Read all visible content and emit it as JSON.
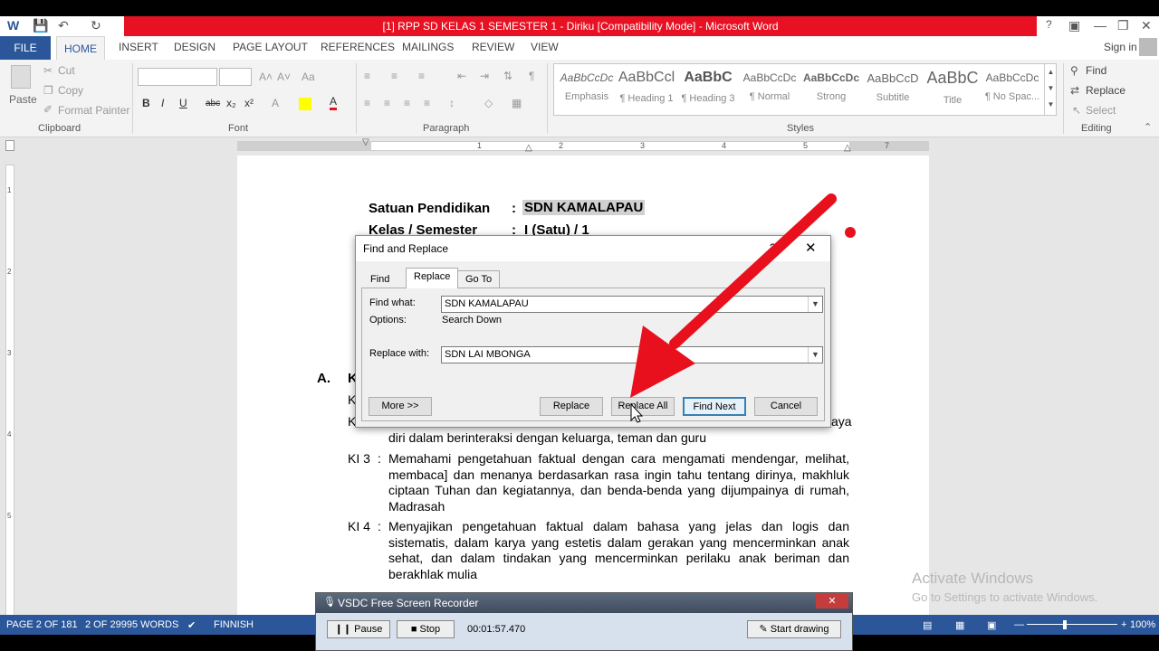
{
  "window": {
    "title": "[1] RPP SD KELAS 1 SEMESTER 1 - Diriku [Compatibility Mode] -  Microsoft Word",
    "help": "?",
    "signin": "Sign in"
  },
  "tabs": [
    "FILE",
    "HOME",
    "INSERT",
    "DESIGN",
    "PAGE LAYOUT",
    "REFERENCES",
    "MAILINGS",
    "REVIEW",
    "VIEW"
  ],
  "clipboard": {
    "paste": "Paste",
    "cut": "Cut",
    "copy": "Copy",
    "format_painter": "Format Painter",
    "group": "Clipboard"
  },
  "font": {
    "group": "Font",
    "bold": "B",
    "italic": "I",
    "underline": "U",
    "strike": "abc",
    "sub": "x₂",
    "sup": "x²",
    "grow": "A˄",
    "shrink": "A˅",
    "case": "Aa"
  },
  "paragraph": {
    "group": "Paragraph"
  },
  "styles": {
    "group": "Styles",
    "items": [
      {
        "preview": "AaBbCcDc",
        "name": "Emphasis"
      },
      {
        "preview": "AaBbCcl",
        "name": "¶ Heading 1"
      },
      {
        "preview": "AaBbC",
        "name": "¶ Heading 3"
      },
      {
        "preview": "AaBbCcDc",
        "name": "¶ Normal"
      },
      {
        "preview": "AaBbCcDc",
        "name": "Strong"
      },
      {
        "preview": "AaBbCcD",
        "name": "Subtitle"
      },
      {
        "preview": "AaBbC",
        "name": "Title"
      },
      {
        "preview": "AaBbCcDc",
        "name": "¶ No Spac..."
      }
    ]
  },
  "editing": {
    "group": "Editing",
    "find": "Find",
    "replace": "Replace",
    "select": "Select"
  },
  "ruler": [
    "1",
    "2",
    "3",
    "4",
    "5",
    "6",
    "7"
  ],
  "vruler": [
    "1",
    "2",
    "3",
    "4",
    "5"
  ],
  "document": {
    "row1_label": "Satuan Pendidikan",
    "row1_colon": ":",
    "row1_value": "SDN KAMALAPAU",
    "row2_label": "Kelas / Semester",
    "row2_colon": ":",
    "row2_value": "I (Satu) / 1",
    "section_letter": "A.",
    "section_initial": "K",
    "ki1_initial": "K",
    "ki2_initial": "K",
    "ki2_tail": "aya",
    "ki2_cont": "diri dalam berinteraksi dengan keluarga, teman dan guru",
    "ki3_label": "KI 3",
    "ki3_colon": ":",
    "ki3_text": "Memahami pengetahuan faktual dengan cara mengamati mendengar, melihat, membaca] dan menanya berdasarkan rasa ingin tahu tentang dirinya, makhluk ciptaan Tuhan dan kegiatannya, dan benda-benda yang dijumpainya di rumah, Madrasah",
    "ki4_label": "KI 4",
    "ki4_colon": ":",
    "ki4_text": "Menyajikan pengetahuan faktual dalam bahasa yang jelas dan logis dan sistematis, dalam karya yang estetis dalam gerakan yang mencerminkan anak sehat, dan dalam tindakan yang mencerminkan perilaku anak beriman dan berakhlak mulia"
  },
  "dialog": {
    "title": "Find and Replace",
    "help": "?",
    "tabs": [
      "Find",
      "Replace",
      "Go To"
    ],
    "find_label": "Find what:",
    "find_value": "SDN KAMALAPAU",
    "options_label": "Options:",
    "options_value": "Search Down",
    "replace_label": "Replace with:",
    "replace_value": "SDN LAI MBONGA",
    "more": "More >>",
    "replace_btn": "Replace",
    "replace_all": "Replace All",
    "find_next": "Find Next",
    "cancel": "Cancel"
  },
  "status": {
    "page": "PAGE 2 OF 181",
    "words": "2 OF 29995 WORDS",
    "lang": "FINNISH",
    "zoom": "100%"
  },
  "recorder": {
    "title": "VSDC Free Screen Recorder",
    "pause": "Pause",
    "stop": "Stop",
    "time": "00:01:57.470",
    "draw": "Start drawing"
  },
  "watermark": {
    "line1": "Activate Windows",
    "line2": "Go to Settings to activate Windows."
  },
  "colors": {
    "accent": "#2b579a",
    "title_red": "#e81123",
    "arrow": "#e8101c"
  }
}
